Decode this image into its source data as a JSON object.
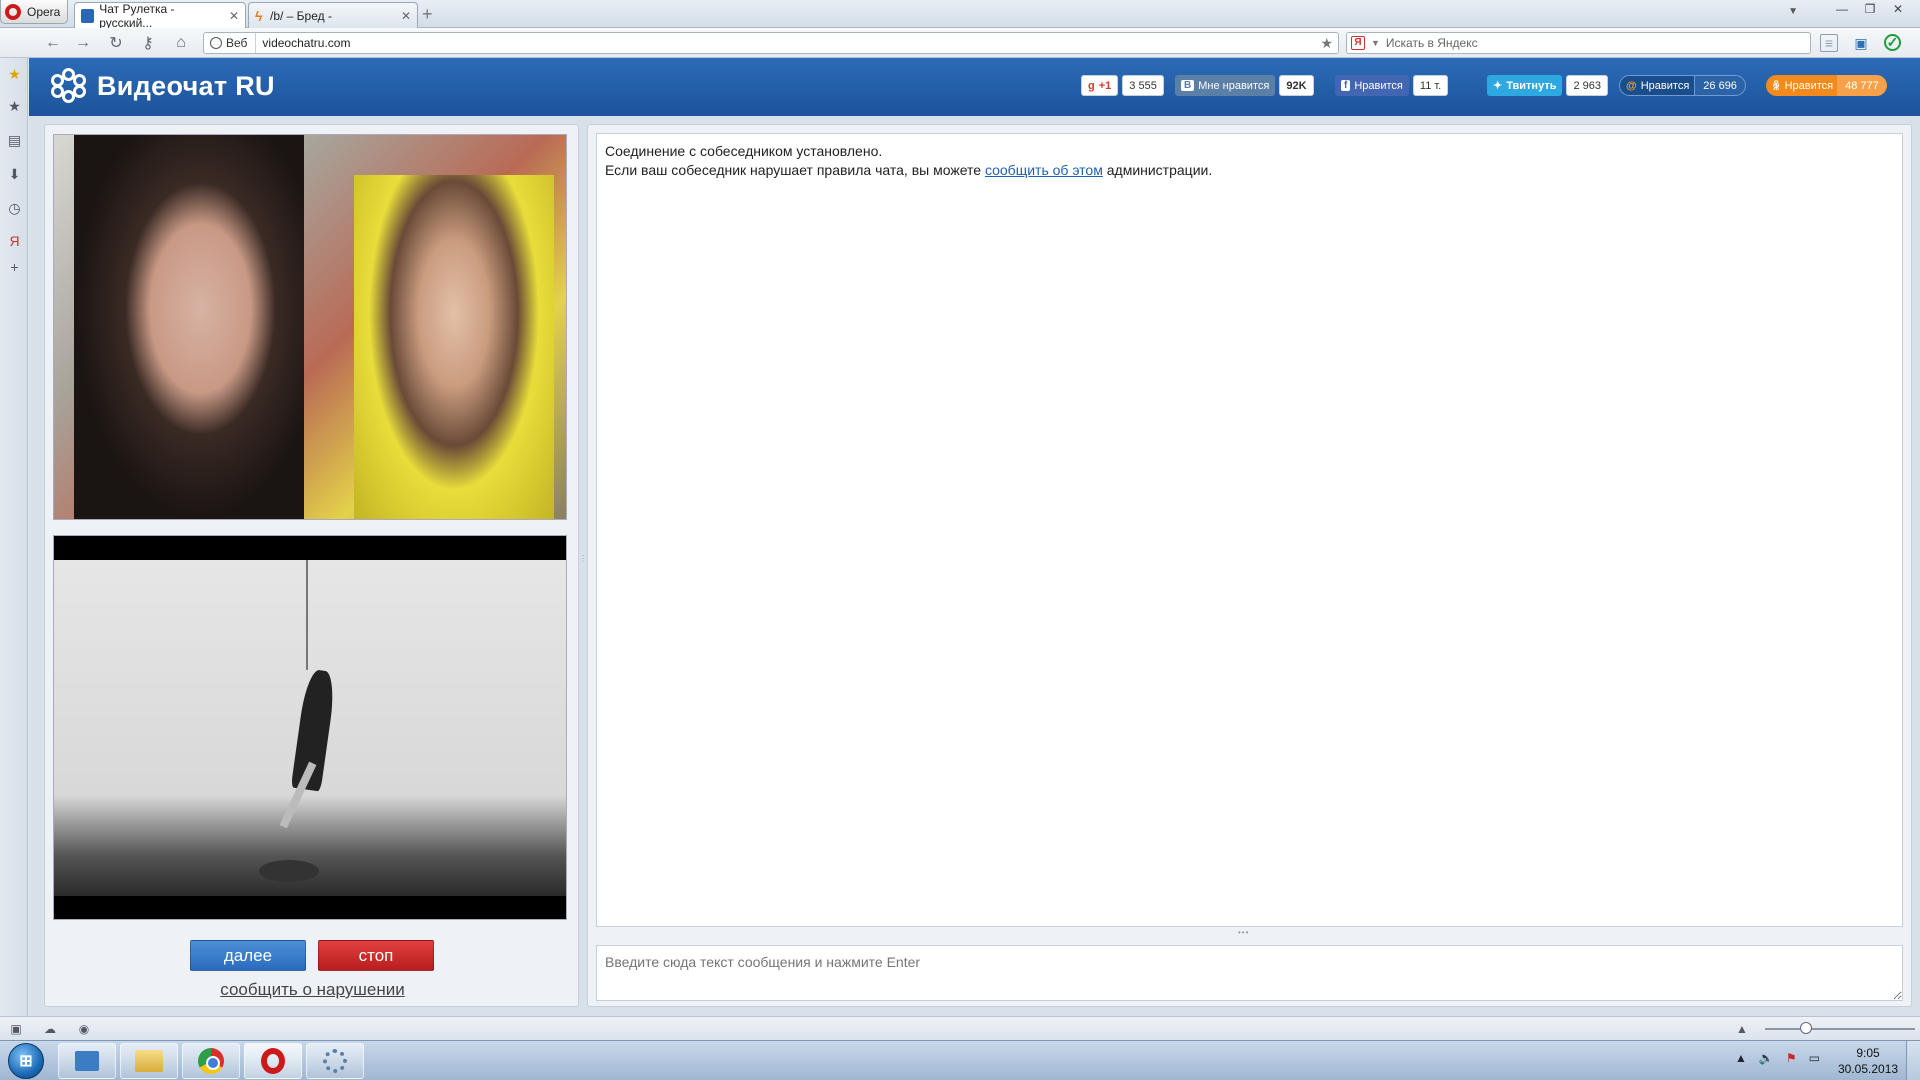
{
  "browser": {
    "menu_label": "Opera",
    "tabs": [
      {
        "title": "Чат Рулетка - русский..."
      },
      {
        "title": "/b/ – Бред -"
      }
    ],
    "address": {
      "site_badge": "Веб",
      "url": "videochatru.com"
    },
    "search": {
      "placeholder": "Искать в Яндекс",
      "engine_badge": "Я"
    }
  },
  "site": {
    "logo_text": "Видеочат RU",
    "social": {
      "gplus": {
        "label": "+1",
        "count": "3 555"
      },
      "vk": {
        "badge": "В",
        "label": "Мне нравится",
        "count": "92K"
      },
      "fb": {
        "badge": "f",
        "label": "Нравится",
        "count": "11 т."
      },
      "twitter": {
        "label": "Твитнуть",
        "count": "2 963"
      },
      "mailru": {
        "label": "Нравится",
        "count": "26 696"
      },
      "ok": {
        "label": "Нравится",
        "count": "48 777"
      }
    },
    "controls": {
      "next_label": "далее",
      "stop_label": "стоп",
      "report_label": "сообщить о нарушении"
    },
    "chat": {
      "line1": "Соединение с собеседником установлено.",
      "line2_before": "Если ваш собеседник нарушает правила чата, вы можете",
      "line2_link": "сообщить об этом",
      "line2_after": "администрации.",
      "input_placeholder": "Введите сюда текст сообщения и нажмите Enter"
    }
  },
  "taskbar": {
    "start_glyph": "⊞",
    "clock_time": "9:05",
    "clock_date": "30.05.2013"
  },
  "colors": {
    "header_blue": "#2c6bb8",
    "next_button": "#2a6cbc",
    "stop_button": "#c62626",
    "link": "#1f5fb0"
  }
}
